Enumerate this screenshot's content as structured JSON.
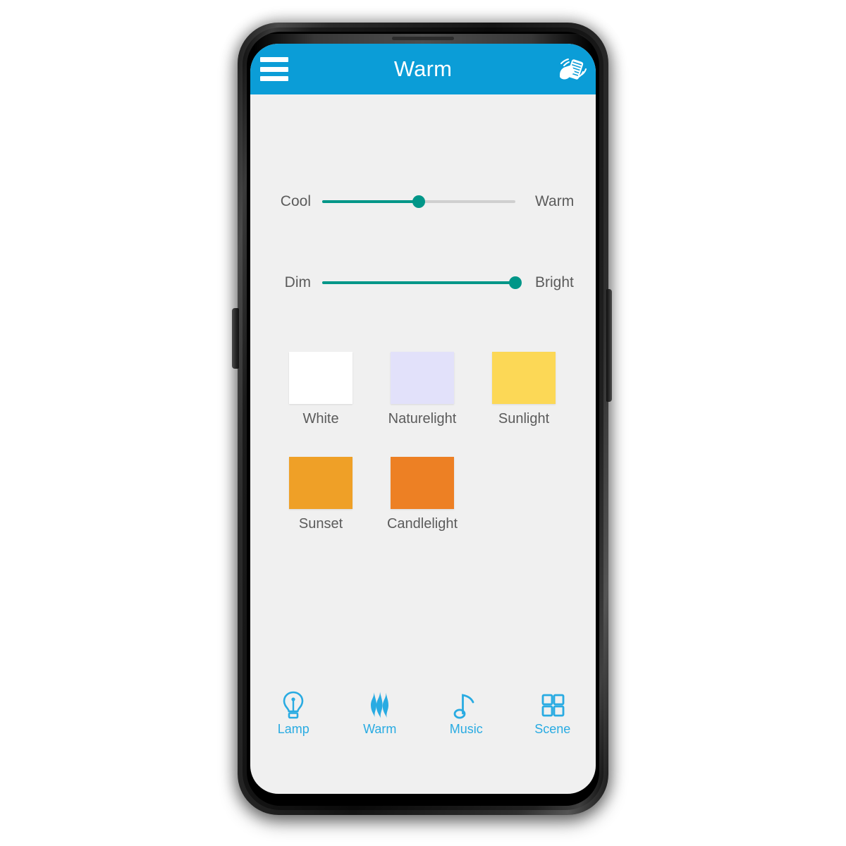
{
  "app": {
    "header": {
      "title": "Warm",
      "menu_icon": "hamburger-menu-icon",
      "action_icon": "shake-phone-icon",
      "background_color": "#0b9dd7",
      "text_color": "#ffffff"
    },
    "sliders": [
      {
        "id": "color-temperature",
        "left_label": "Cool",
        "right_label": "Warm",
        "value_percent": 50,
        "track_color": "#cfcfcf",
        "fill_color": "#009688",
        "thumb_color": "#009688"
      },
      {
        "id": "brightness",
        "left_label": "Dim",
        "right_label": "Bright",
        "value_percent": 100,
        "track_color": "#cfcfcf",
        "fill_color": "#009688",
        "thumb_color": "#009688"
      }
    ],
    "presets": [
      {
        "label": "White",
        "color": "#ffffff"
      },
      {
        "label": "Naturelight",
        "color": "#e2e1fa"
      },
      {
        "label": "Sunlight",
        "color": "#fcd856"
      },
      {
        "label": "Sunset",
        "color": "#efa027"
      },
      {
        "label": "Candlelight",
        "color": "#ed8024"
      }
    ],
    "bottom_nav": {
      "active_color": "#29abe2",
      "items": [
        {
          "label": "Lamp",
          "icon": "lightbulb-icon"
        },
        {
          "label": "Warm",
          "icon": "flame-waves-icon"
        },
        {
          "label": "Music",
          "icon": "music-note-icon"
        },
        {
          "label": "Scene",
          "icon": "grid-squares-icon"
        }
      ]
    },
    "screen_background": "#f0f0f0"
  }
}
